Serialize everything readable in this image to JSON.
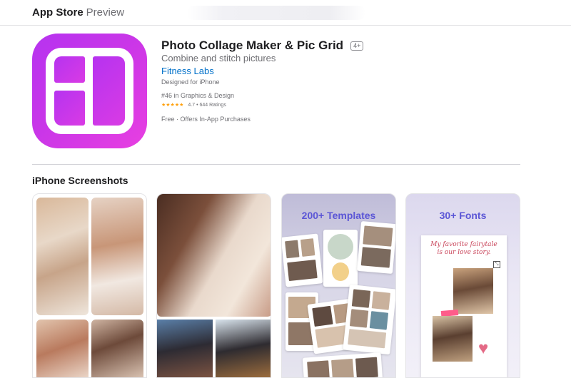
{
  "header": {
    "brand_main": "App Store",
    "brand_sub": "Preview"
  },
  "app": {
    "title": "Photo Collage Maker & Pic Grid",
    "age_rating": "4+",
    "subtitle": "Combine and stitch pictures",
    "developer": "Fitness Labs",
    "designed_for": "Designed for iPhone",
    "rank": "#46 in Graphics & Design",
    "stars": "★★★★★",
    "rating_value": 4.7,
    "rating_text": "4.7 • 644 Ratings",
    "price": "Free · Offers In-App Purchases",
    "icon_colors": [
      "#b633f0",
      "#e83fe1"
    ]
  },
  "screenshots": {
    "section_title": "iPhone Screenshots",
    "items": [
      {
        "caption": ""
      },
      {
        "caption": ""
      },
      {
        "caption": "200+ Templates"
      },
      {
        "caption": "30+ Fonts",
        "card_note": "My favorite fairytale is our love story."
      }
    ]
  },
  "colors": {
    "link": "#0070c9",
    "star": "#ff9f0a",
    "promo_text": "#5b56d6"
  }
}
